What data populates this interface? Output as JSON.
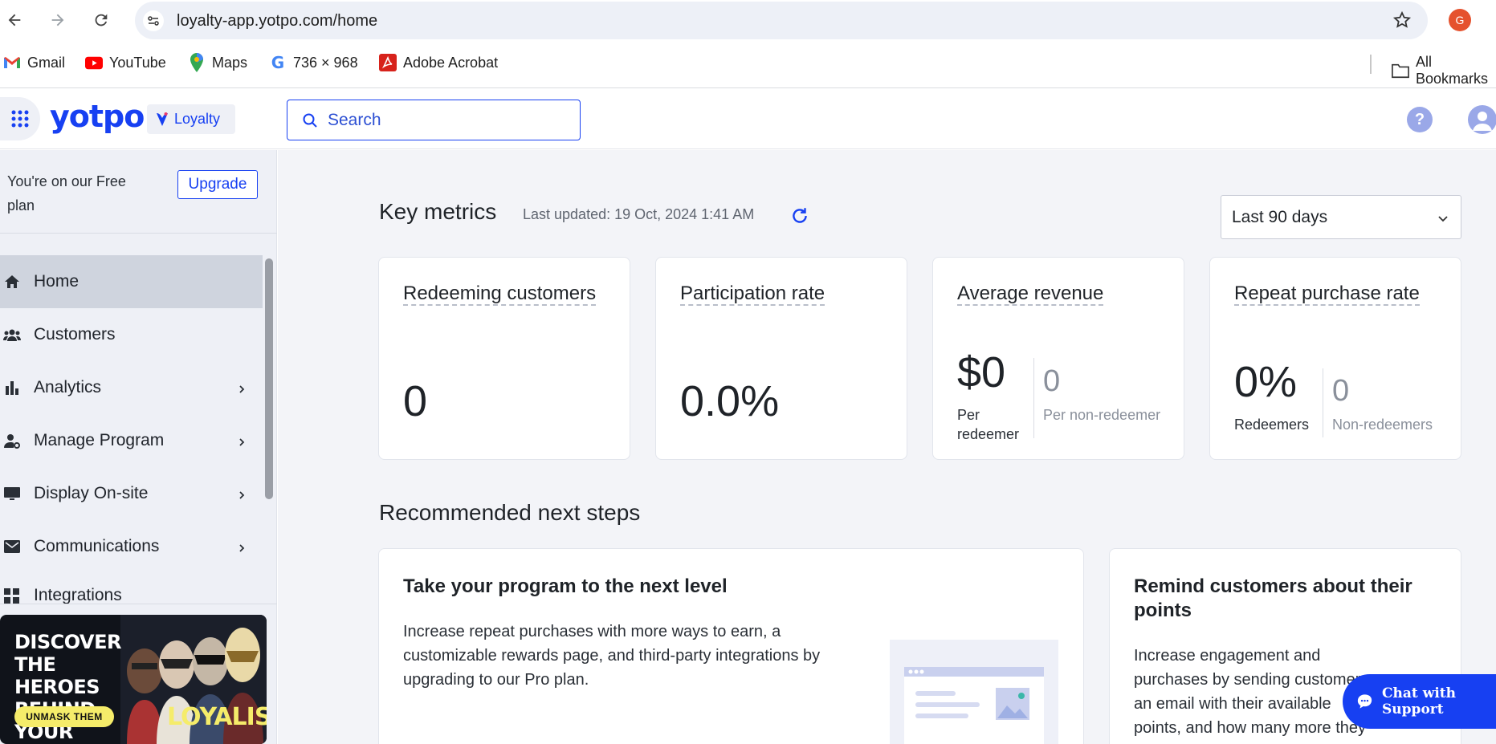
{
  "browser": {
    "url": "loyalty-app.yotpo.com/home",
    "profile_initial": "G"
  },
  "bookmarks": [
    {
      "label": "Gmail",
      "icon": "gmail-icon"
    },
    {
      "label": "YouTube",
      "icon": "youtube-icon"
    },
    {
      "label": "Maps",
      "icon": "maps-icon"
    },
    {
      "label": "736 × 968",
      "icon": "google-icon"
    },
    {
      "label": "Adobe Acrobat",
      "icon": "acrobat-icon"
    }
  ],
  "bookmarks_all": "All Bookmarks",
  "header": {
    "logo": "yotpo.",
    "product_chip": "Loyalty",
    "search_placeholder": "Search"
  },
  "sidebar": {
    "plan_text": "You're on our Free plan",
    "upgrade_label": "Upgrade",
    "items": [
      {
        "label": "Home",
        "icon": "home-icon",
        "active": true
      },
      {
        "label": "Customers",
        "icon": "customers-icon"
      },
      {
        "label": "Analytics",
        "icon": "analytics-icon",
        "has_submenu": true
      },
      {
        "label": "Manage Program",
        "icon": "manage-program-icon",
        "has_submenu": true
      },
      {
        "label": "Display On-site",
        "icon": "display-icon",
        "has_submenu": true
      },
      {
        "label": "Communications",
        "icon": "mail-icon",
        "has_submenu": true
      },
      {
        "label": "Integrations",
        "icon": "integrations-icon"
      }
    ],
    "promo": {
      "title": "DISCOVER THE HEROES BEHIND YOUR BRAND",
      "cta": "UNMASK THEM",
      "brand": "LOYALISTS"
    }
  },
  "main": {
    "key_metrics_title": "Key metrics",
    "last_updated": "Last updated:  19 Oct, 2024 1:41 AM",
    "date_range": "Last 90 days",
    "metrics": [
      {
        "title": "Redeeming customers",
        "value": "0"
      },
      {
        "title": "Participation rate",
        "value": "0.0%"
      },
      {
        "title": "Average revenue",
        "value": "$0",
        "value_label": "Per redeemer",
        "secondary_value": "0",
        "secondary_label": "Per non-redeemer"
      },
      {
        "title": "Repeat purchase rate",
        "value": "0%",
        "value_label": "Redeemers",
        "secondary_value": "0",
        "secondary_label": "Non-redeemers"
      }
    ],
    "recommended_title": "Recommended next steps",
    "recommendations": [
      {
        "title": "Take your program to the next level",
        "body": "Increase repeat purchases with more ways to earn, a customizable rewards page, and third-party integrations by upgrading to our Pro plan."
      },
      {
        "title": "Remind customers about their points",
        "body": "Increase engagement and purchases by sending customers an email with their available points, and how many more they"
      }
    ]
  },
  "chat": {
    "label": "Chat with Support"
  },
  "colors": {
    "brand": "#1740f2",
    "sidebar_bg": "#eef0f6",
    "main_bg": "#f3f4f8"
  }
}
